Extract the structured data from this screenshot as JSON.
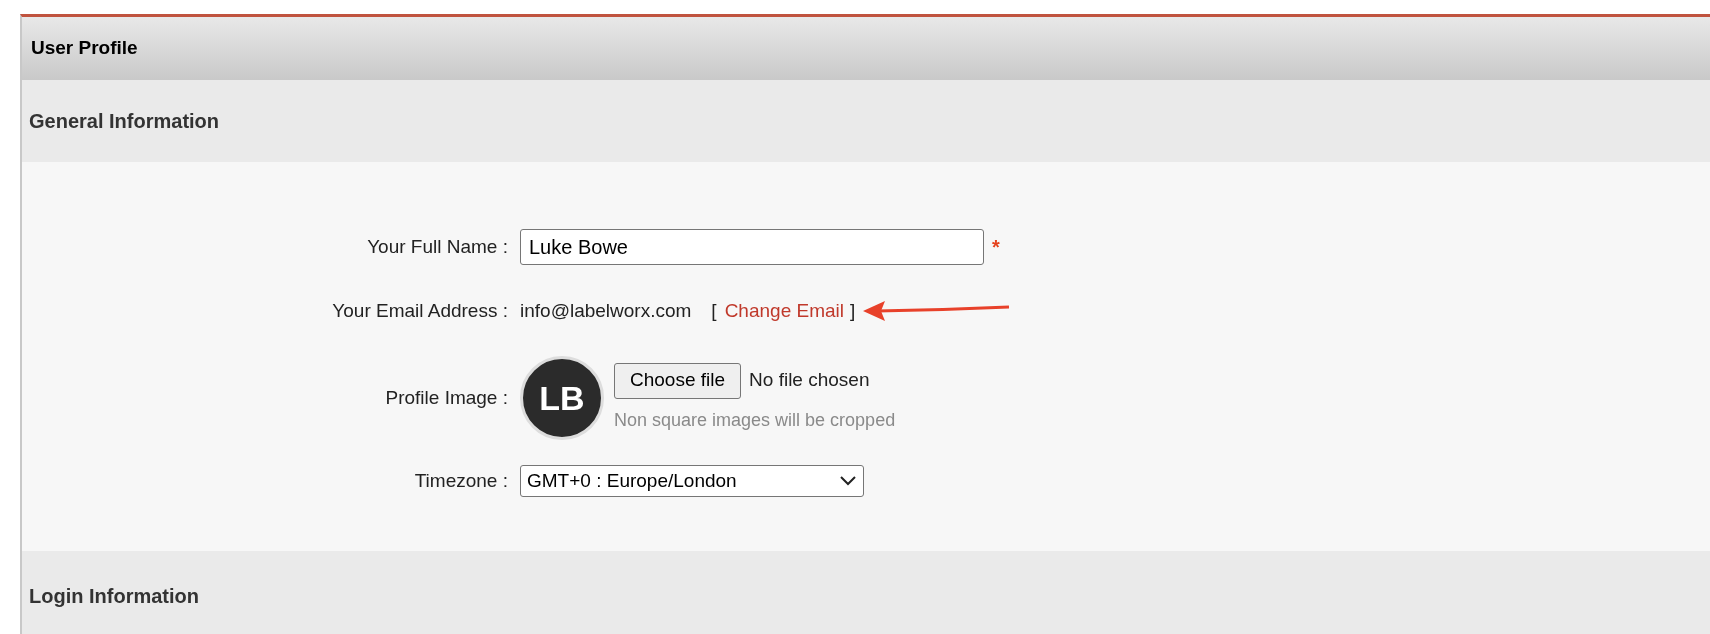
{
  "panel": {
    "title": "User Profile"
  },
  "general": {
    "title": "General Information",
    "fields": [
      {
        "kind": "text",
        "label": "Your Full Name :",
        "value": "Luke Bowe",
        "required_mark": "*"
      },
      {
        "kind": "email",
        "label": "Your Email Address :",
        "value": "info@labelworx.com",
        "open_bracket": "[",
        "link": "Change Email",
        "close_bracket": "]",
        "annotated": true
      },
      {
        "kind": "image",
        "label": "Profile Image :",
        "avatar_initials": "LB",
        "button": "Choose file",
        "file_status": "No file chosen",
        "hint": "Non square images will be cropped"
      },
      {
        "kind": "select",
        "label": "Timezone :",
        "value": "GMT+0 : Europe/London"
      }
    ]
  },
  "login": {
    "title": "Login Information"
  }
}
